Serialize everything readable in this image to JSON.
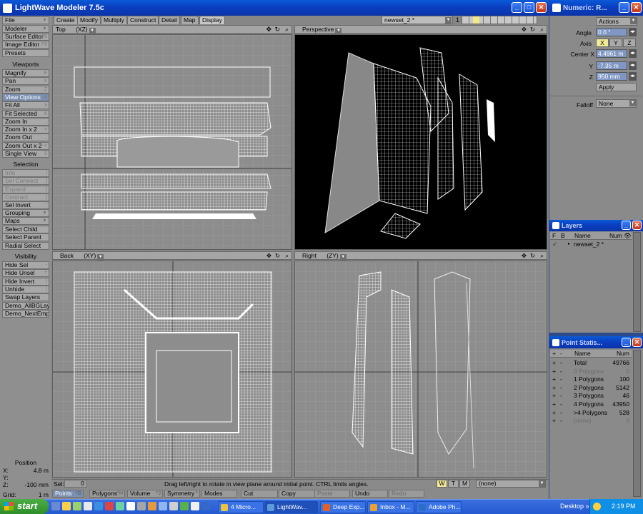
{
  "app": {
    "title": "LightWave Modeler 7.5c"
  },
  "top_menu": {
    "file": "File",
    "modeler": "Modeler"
  },
  "side": {
    "top_items": [
      {
        "label": "Surface Editor",
        "key": "F5"
      },
      {
        "label": "Image Editor",
        "key": "F6"
      },
      {
        "label": "Presets",
        "key": ""
      }
    ],
    "viewports_hdr": "Viewports",
    "viewport_items": [
      {
        "label": "Magnify",
        "key": "E"
      },
      {
        "label": "Pan",
        "key": "X"
      },
      {
        "label": "Zoom",
        "key": "Z"
      },
      {
        "label": "View Options",
        "key": "d"
      },
      {
        "label": "Fit All",
        "key": "a"
      },
      {
        "label": "Fit Selected",
        "key": "A"
      },
      {
        "label": "Zoom In",
        "key": "."
      },
      {
        "label": "Zoom In x 2",
        "key": ">"
      },
      {
        "label": "Zoom Out",
        "key": ","
      },
      {
        "label": "Zoom Out x 2",
        "key": "<"
      },
      {
        "label": "Single View",
        "key": "0"
      }
    ],
    "selection_hdr": "Selection",
    "selection_items": [
      {
        "label": "Info",
        "key": "i"
      },
      {
        "label": "Sel Connect",
        "key": "]"
      },
      {
        "label": "Expand",
        "key": "}"
      },
      {
        "label": "Contract",
        "key": "{"
      },
      {
        "label": "Sel Invert",
        "key": "\""
      }
    ],
    "grouping": "Grouping",
    "maps": "Maps",
    "select_items": [
      {
        "label": "Select Child",
        "key": ""
      },
      {
        "label": "Select Parent",
        "key": ""
      },
      {
        "label": "Radial Select",
        "key": ""
      }
    ],
    "visibility_hdr": "Visibility",
    "visibility_items": [
      {
        "label": "Hide Sel",
        "key": "-"
      },
      {
        "label": "Hide Unsel",
        "key": "="
      },
      {
        "label": "Hide Invert",
        "key": "\\"
      },
      {
        "label": "Unhide",
        "key": "|"
      },
      {
        "label": "Swap Layers",
        "key": ""
      },
      {
        "label": "Demo_AllBGLay",
        "key": ""
      },
      {
        "label": "Demo_NextEmpt",
        "key": ""
      }
    ],
    "position_label": "Position",
    "position": {
      "x_label": "X:",
      "x": "4.8 m",
      "y_label": "Y:",
      "y": "",
      "z_label": "Z:",
      "z": "-100 mm"
    },
    "grid_label": "Grid:",
    "grid_value": "1 m"
  },
  "tabs": [
    "Create",
    "Modify",
    "Multiply",
    "Construct",
    "Detail",
    "Map",
    "Display"
  ],
  "active_tab": "Display",
  "layer_select": "newset_2 *",
  "layer_num": "1",
  "viewports": {
    "top": {
      "name": "Top",
      "axes": "(XZ)"
    },
    "persp": {
      "name": "Perspective"
    },
    "back": {
      "name": "Back",
      "axes": "(XY)"
    },
    "right": {
      "name": "Right",
      "axes": "(ZY)"
    }
  },
  "status": {
    "sel_label": "Sel:",
    "sel_value": "0",
    "message": "Drag left/right to rotate in view plane around initial point. CTRL limits angles.",
    "w": "W",
    "t": "T",
    "m": "M",
    "dropdown": "(none)"
  },
  "mode_buttons": [
    {
      "label": "Points",
      "key": "^G"
    },
    {
      "label": "Polygons",
      "key": "^H"
    },
    {
      "label": "Volume",
      "key": "^J"
    },
    {
      "label": "Symmetry",
      "key": "^"
    },
    {
      "label": "Modes",
      "key": ""
    },
    {
      "label": "Cut",
      "key": ""
    },
    {
      "label": "Copy",
      "key": ""
    },
    {
      "label": "Paste",
      "key": ""
    },
    {
      "label": "Undo",
      "key": ""
    },
    {
      "label": "Redo",
      "key": ""
    }
  ],
  "numeric": {
    "title": "Numeric: R...",
    "actions": "Actions",
    "angle_label": "Angle",
    "angle": "0.0 °",
    "axis_label": "Axis",
    "axis_x": "X",
    "axis_y": "Y",
    "axis_z": "Z",
    "center_label": "Center X",
    "center_x": "4.4961 m",
    "y_label": "Y",
    "y": "-7.35 m",
    "z_label": "Z",
    "z": "950 mm",
    "apply": "Apply",
    "falloff_label": "Falloff",
    "falloff": "None"
  },
  "layers": {
    "title": "Layers",
    "col_f": "F",
    "col_b": "B",
    "col_name": "Name",
    "col_num": "Num",
    "row_name": "newset_2 *"
  },
  "point_stats": {
    "title": "Point Statis...",
    "col_name": "Name",
    "col_num": "Num",
    "rows": [
      {
        "name": "Total",
        "num": "49766"
      },
      {
        "name": "0 Polygons",
        "num": "0"
      },
      {
        "name": "1 Polygons",
        "num": "100"
      },
      {
        "name": "2 Polygons",
        "num": "5142"
      },
      {
        "name": "3 Polygons",
        "num": "46"
      },
      {
        "name": "4 Polygons",
        "num": "43950"
      },
      {
        "name": ">4 Polygons",
        "num": "528"
      },
      {
        "name": "(none)",
        "num": "0"
      }
    ]
  },
  "taskbar": {
    "start": "start",
    "buttons": [
      {
        "label": "4 Micro...",
        "color": "#e9c341"
      },
      {
        "label": "LightWav...",
        "color": "#5c9bd8"
      },
      {
        "label": "Deep Exp...",
        "color": "#e0622a"
      },
      {
        "label": "Inbox - M...",
        "color": "#e7a235"
      },
      {
        "label": "Adobe Ph...",
        "color": "#2c6ec8"
      }
    ],
    "desktop": "Desktop",
    "clock": "2:19 PM"
  }
}
